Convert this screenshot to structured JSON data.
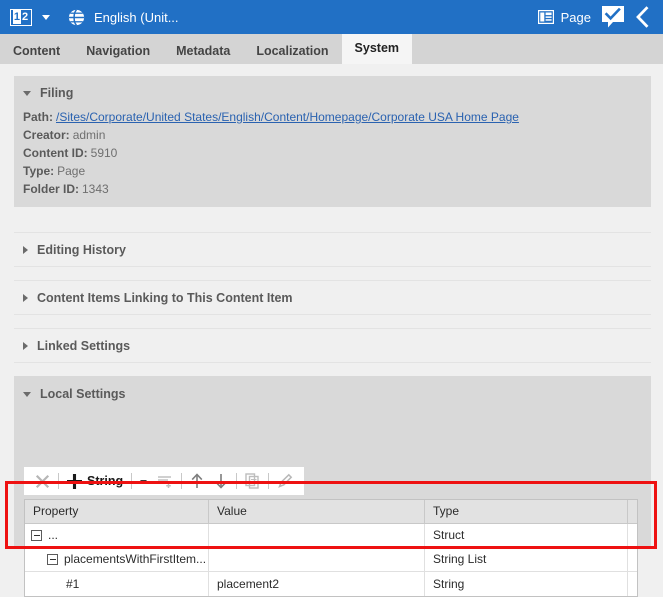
{
  "titlebar": {
    "version_badge": {
      "first": "1",
      "second": "2"
    },
    "language": "English (Unit...",
    "page_label": "Page",
    "icons": {
      "dropdown": "chevron-down-icon",
      "globe": "globe-icon",
      "page": "page-icon",
      "approved": "check-badge-icon",
      "collapse": "chevron-left-icon"
    }
  },
  "tabs": [
    {
      "label": "Content",
      "active": false
    },
    {
      "label": "Navigation",
      "active": false
    },
    {
      "label": "Metadata",
      "active": false
    },
    {
      "label": "Localization",
      "active": false
    },
    {
      "label": "System",
      "active": true
    }
  ],
  "sections": {
    "filing": {
      "title": "Filing",
      "expanded": true,
      "fields": [
        {
          "label": "Path:",
          "value": "/Sites/Corporate/United States/English/Content/Homepage/Corporate USA Home Page",
          "is_link": true
        },
        {
          "label": "Creator:",
          "value": "admin",
          "is_link": false
        },
        {
          "label": "Content ID:",
          "value": "5910",
          "is_link": false
        },
        {
          "label": "Type:",
          "value": "Page",
          "is_link": false
        },
        {
          "label": "Folder ID:",
          "value": "1343",
          "is_link": false
        }
      ]
    },
    "editing_history": {
      "title": "Editing History",
      "expanded": false
    },
    "linking_items": {
      "title": "Content Items Linking to This Content Item",
      "expanded": false
    },
    "linked_settings": {
      "title": "Linked Settings",
      "expanded": false
    },
    "local_settings": {
      "title": "Local Settings",
      "expanded": true
    }
  },
  "toolbar": {
    "delete_label": "delete-icon",
    "add_label": "String",
    "add_dropdown": "chevron-down-icon",
    "add_list_label": "add-list-icon",
    "move_up_label": "arrow-up-icon",
    "move_down_label": "arrow-down-icon",
    "copy_label": "copy-icon",
    "edit_label": "pencil-icon"
  },
  "grid": {
    "columns": [
      "Property",
      "Value",
      "Type"
    ],
    "rows": [
      {
        "property": "...",
        "value": "",
        "type": "Struct",
        "indent": 0,
        "has_expander": true
      },
      {
        "property": "placementsWithFirstItem...",
        "value": "",
        "type": "String List",
        "indent": 1,
        "has_expander": true
      },
      {
        "property": "#1",
        "value": "placement2",
        "type": "String",
        "indent": 2,
        "has_expander": false
      }
    ]
  },
  "highlight": {
    "color": "#ee1111"
  }
}
